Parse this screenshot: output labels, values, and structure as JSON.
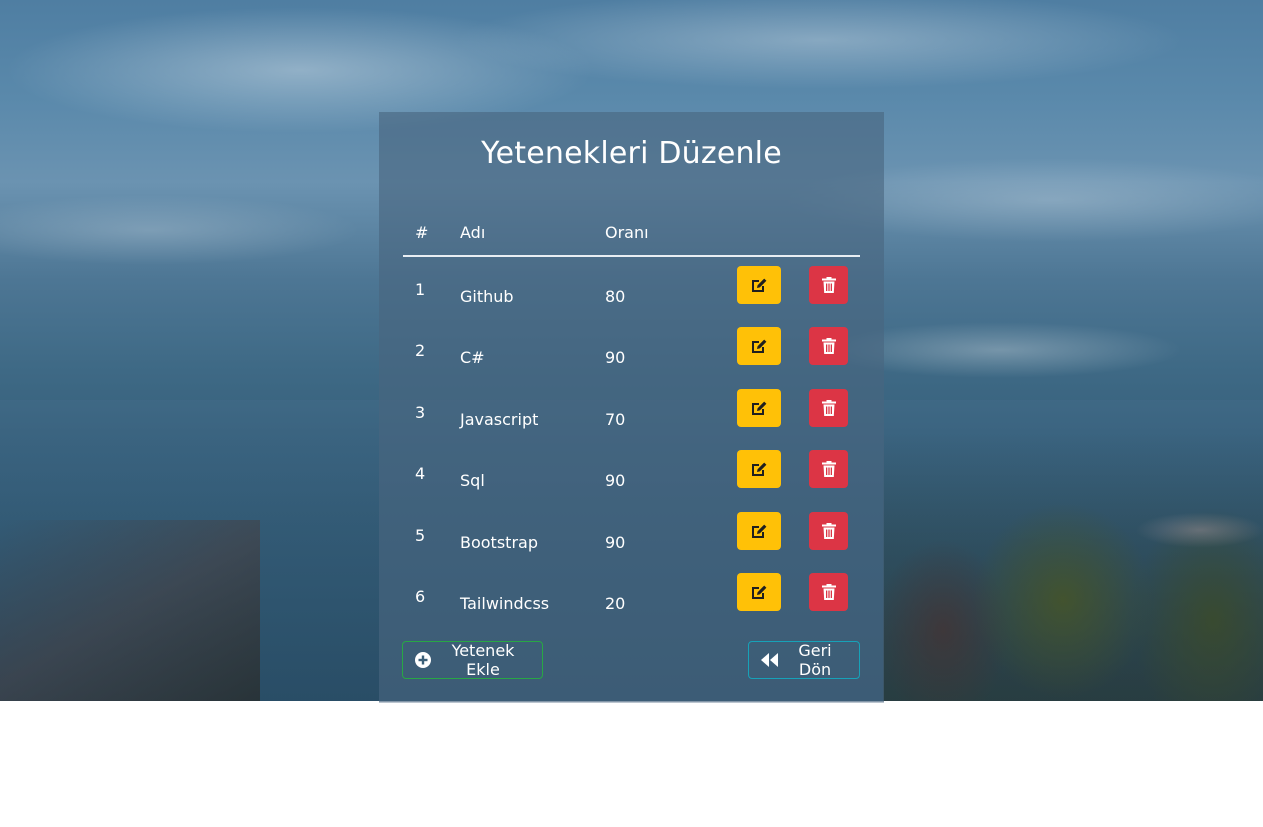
{
  "page": {
    "title": "Yetenekleri Düzenle"
  },
  "table": {
    "headers": {
      "num": "#",
      "name": "Adı",
      "rate": "Oranı"
    },
    "rows": [
      {
        "num": "1",
        "name": "Github",
        "rate": "80"
      },
      {
        "num": "2",
        "name": "C#",
        "rate": "90"
      },
      {
        "num": "3",
        "name": "Javascript",
        "rate": "70"
      },
      {
        "num": "4",
        "name": "Sql",
        "rate": "90"
      },
      {
        "num": "5",
        "name": "Bootstrap",
        "rate": "90"
      },
      {
        "num": "6",
        "name": "Tailwindcss",
        "rate": "20"
      }
    ]
  },
  "actions": {
    "add_label": "Yetenek Ekle",
    "back_label": "Geri Dön"
  },
  "icons": {
    "edit": "edit-icon",
    "delete": "trash-icon",
    "add": "plus-circle-icon",
    "back": "backward-icon"
  },
  "colors": {
    "edit_button": "#ffc107",
    "delete_button": "#dc3545",
    "add_button_border": "#28a745",
    "back_button_border": "#17a2b8"
  }
}
